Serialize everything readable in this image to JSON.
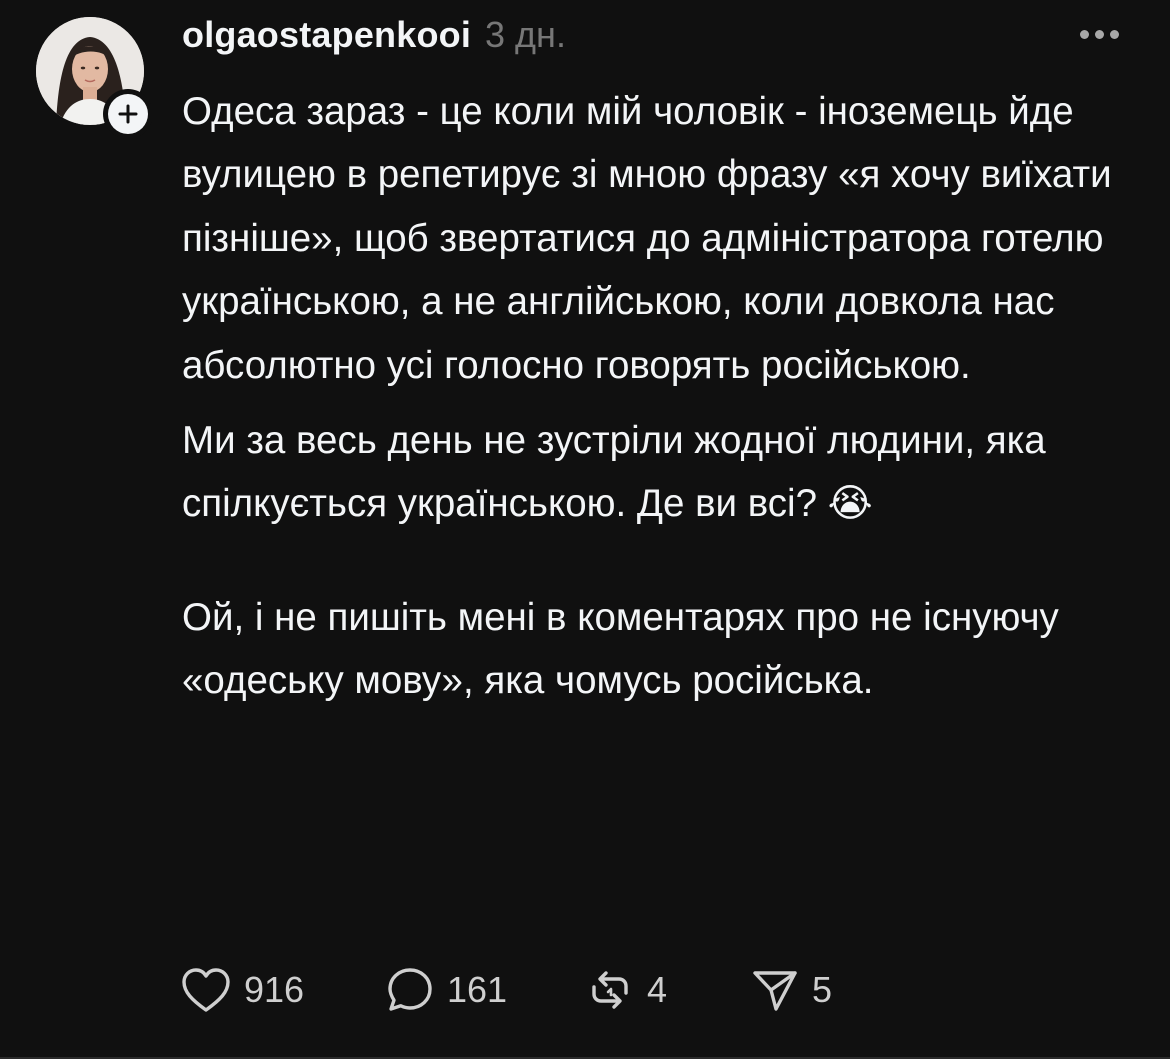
{
  "post": {
    "username": "olgaostapenkooi",
    "timestamp": "3 дн.",
    "paragraphs": [
      "Одеса зараз - це коли мій чоловік - іноземець йде вулицею в репетирує зі мною фразу «я хочу виїхати пізніше», щоб звертатися до адміністратора готелю українською, а не англійською, коли довкола нас абсолютно усі голосно говорять російською.",
      "Ми за весь день не зустріли жодної людини, яка спілкується українською. Де ви всі? 😭",
      "Ой, і не пишіть мені в коментарях про не існуючу «одеську мову», яка чомусь російська."
    ]
  },
  "actions": {
    "likes": "916",
    "comments": "161",
    "reposts": "4",
    "shares": "5"
  },
  "icons": {
    "more": "more-horizontal-icon",
    "follow": "plus-icon",
    "like": "heart-icon",
    "comment": "comment-bubble-icon",
    "repost": "repost-icon",
    "share": "send-icon"
  },
  "colors": {
    "background": "#101010",
    "text": "#f3f5f7",
    "secondary": "#777777"
  }
}
